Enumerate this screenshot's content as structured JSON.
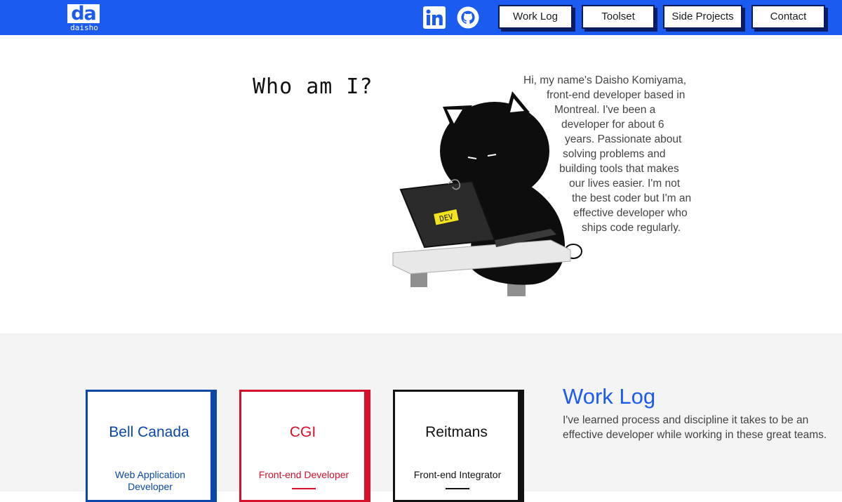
{
  "header": {
    "logo_mark": "da",
    "logo_word": "daisho",
    "nav": {
      "work_log": "Work Log",
      "toolset": "Toolset",
      "side_projects": "Side Projects",
      "contact": "Contact"
    },
    "social_icons": [
      "linkedin-icon",
      "github-icon"
    ]
  },
  "about": {
    "title": "Who am I?",
    "laptop_sticker": "DEV",
    "bio_lines": [
      "Hi, my name's Daisho Komiyama,",
      "front-end developer based in",
      "Montreal. I've been a",
      "developer for about 6",
      "years. Passionate about",
      "solving problems and",
      "building tools that makes",
      "our lives easier. I'm not",
      "the best coder but I'm an",
      "effective developer who",
      "ships code regularly."
    ]
  },
  "work": {
    "title": "Work Log",
    "description": "I've learned process and discipline it takes to be an effective developer while working in these great teams.",
    "cards": [
      {
        "company": "Bell Canada",
        "role": "Web Application Developer"
      },
      {
        "company": "CGI",
        "role": "Front-end Developer"
      },
      {
        "company": "Reitmans",
        "role": "Front-end Integrator"
      }
    ]
  },
  "colors": {
    "brand_blue": "#1c5bf0",
    "bell_blue": "#0a47a8",
    "cgi_red": "#d4102a",
    "reitmans_black": "#111111",
    "section_gray": "#f4f4f4"
  }
}
